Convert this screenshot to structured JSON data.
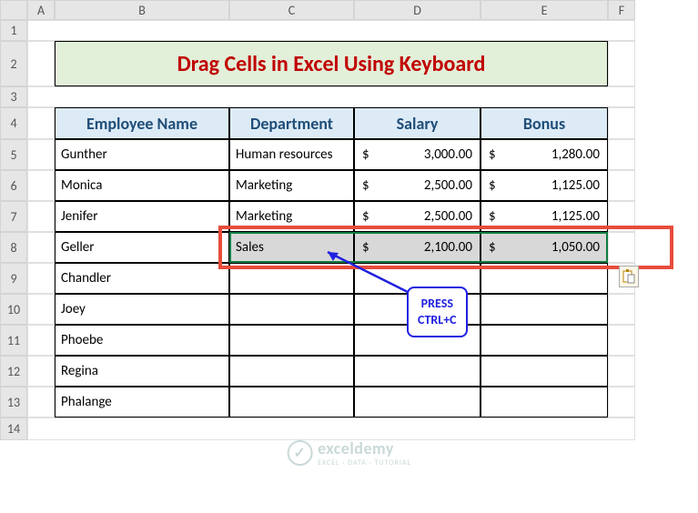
{
  "cols": [
    "",
    "A",
    "B",
    "C",
    "D",
    "E",
    "F"
  ],
  "rows": [
    "1",
    "2",
    "3",
    "4",
    "5",
    "6",
    "7",
    "8",
    "9",
    "10",
    "11",
    "12",
    "13",
    "14"
  ],
  "title": "Drag Cells in Excel Using Keyboard",
  "headers": {
    "name": "Employee Name",
    "dept": "Department",
    "salary": "Salary",
    "bonus": "Bonus"
  },
  "data": [
    {
      "name": "Gunther",
      "dept": "Human resources",
      "salary": "3,000.00",
      "bonus": "1,280.00"
    },
    {
      "name": "Monica",
      "dept": "Marketing",
      "salary": "2,500.00",
      "bonus": "1,125.00"
    },
    {
      "name": "Jenifer",
      "dept": "Marketing",
      "salary": "2,500.00",
      "bonus": "1,125.00"
    },
    {
      "name": "Geller",
      "dept": "Sales",
      "salary": "2,100.00",
      "bonus": "1,050.00"
    },
    {
      "name": "Chandler",
      "dept": "",
      "salary": "",
      "bonus": ""
    },
    {
      "name": "Joey",
      "dept": "",
      "salary": "",
      "bonus": ""
    },
    {
      "name": "Phoebe",
      "dept": "",
      "salary": "",
      "bonus": ""
    },
    {
      "name": "Regina",
      "dept": "",
      "salary": "",
      "bonus": ""
    },
    {
      "name": "Phalange",
      "dept": "",
      "salary": "",
      "bonus": ""
    }
  ],
  "currency": "$",
  "callout": "PRESS\nCTRL+C",
  "watermark": {
    "logo": "✓",
    "main": "exceldemy",
    "sub": "EXCEL · DATA · TUTORIAL"
  },
  "chart_data": {
    "type": "table",
    "title": "Drag Cells in Excel Using Keyboard",
    "columns": [
      "Employee Name",
      "Department",
      "Salary",
      "Bonus"
    ],
    "rows": [
      [
        "Gunther",
        "Human resources",
        3000.0,
        1280.0
      ],
      [
        "Monica",
        "Marketing",
        2500.0,
        1125.0
      ],
      [
        "Jenifer",
        "Marketing",
        2500.0,
        1125.0
      ],
      [
        "Geller",
        "Sales",
        2100.0,
        1050.0
      ],
      [
        "Chandler",
        null,
        null,
        null
      ],
      [
        "Joey",
        null,
        null,
        null
      ],
      [
        "Phoebe",
        null,
        null,
        null
      ],
      [
        "Regina",
        null,
        null,
        null
      ],
      [
        "Phalange",
        null,
        null,
        null
      ]
    ]
  }
}
